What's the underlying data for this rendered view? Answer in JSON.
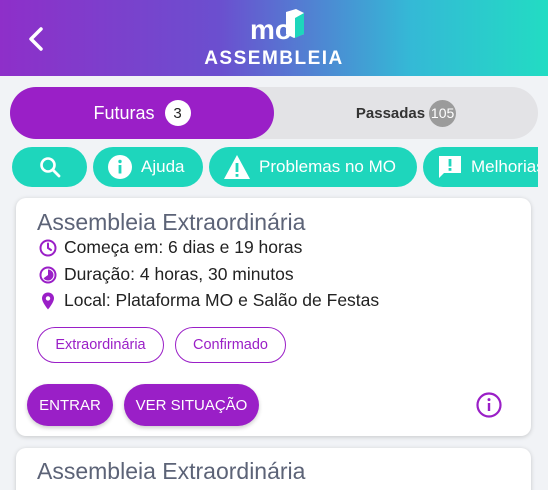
{
  "header": {
    "logo_text": "mo",
    "title": "ASSEMBLEIA",
    "back_icon": "chevron-left-icon"
  },
  "tabs": [
    {
      "label": "Futuras",
      "count": "3",
      "active": true
    },
    {
      "label": "Passadas",
      "count": "105",
      "active": false
    }
  ],
  "chips": [
    {
      "icon": "search-icon",
      "label": ""
    },
    {
      "icon": "info-icon",
      "label": "Ajuda"
    },
    {
      "icon": "warning-icon",
      "label": "Problemas no MO"
    },
    {
      "icon": "feedback-icon",
      "label": "Melhorias"
    }
  ],
  "assemblies": [
    {
      "title": "Assembleia Extraordinária",
      "starts": "Começa em: 6 dias e 19 horas",
      "duration": "Duração: 4 horas, 30 minutos",
      "location": "Local: Plataforma MO e Salão de Festas",
      "tags": [
        "Extraordinária",
        "Confirmado"
      ],
      "enter_label": "ENTRAR",
      "status_label": "VER SITUAÇÃO"
    },
    {
      "title": "Assembleia Extraordinária"
    }
  ],
  "colors": {
    "primary": "#9a1fc7",
    "teal": "#1ed6bc",
    "gradient_start": "#8e2fc9",
    "gradient_end": "#22dcc3"
  }
}
